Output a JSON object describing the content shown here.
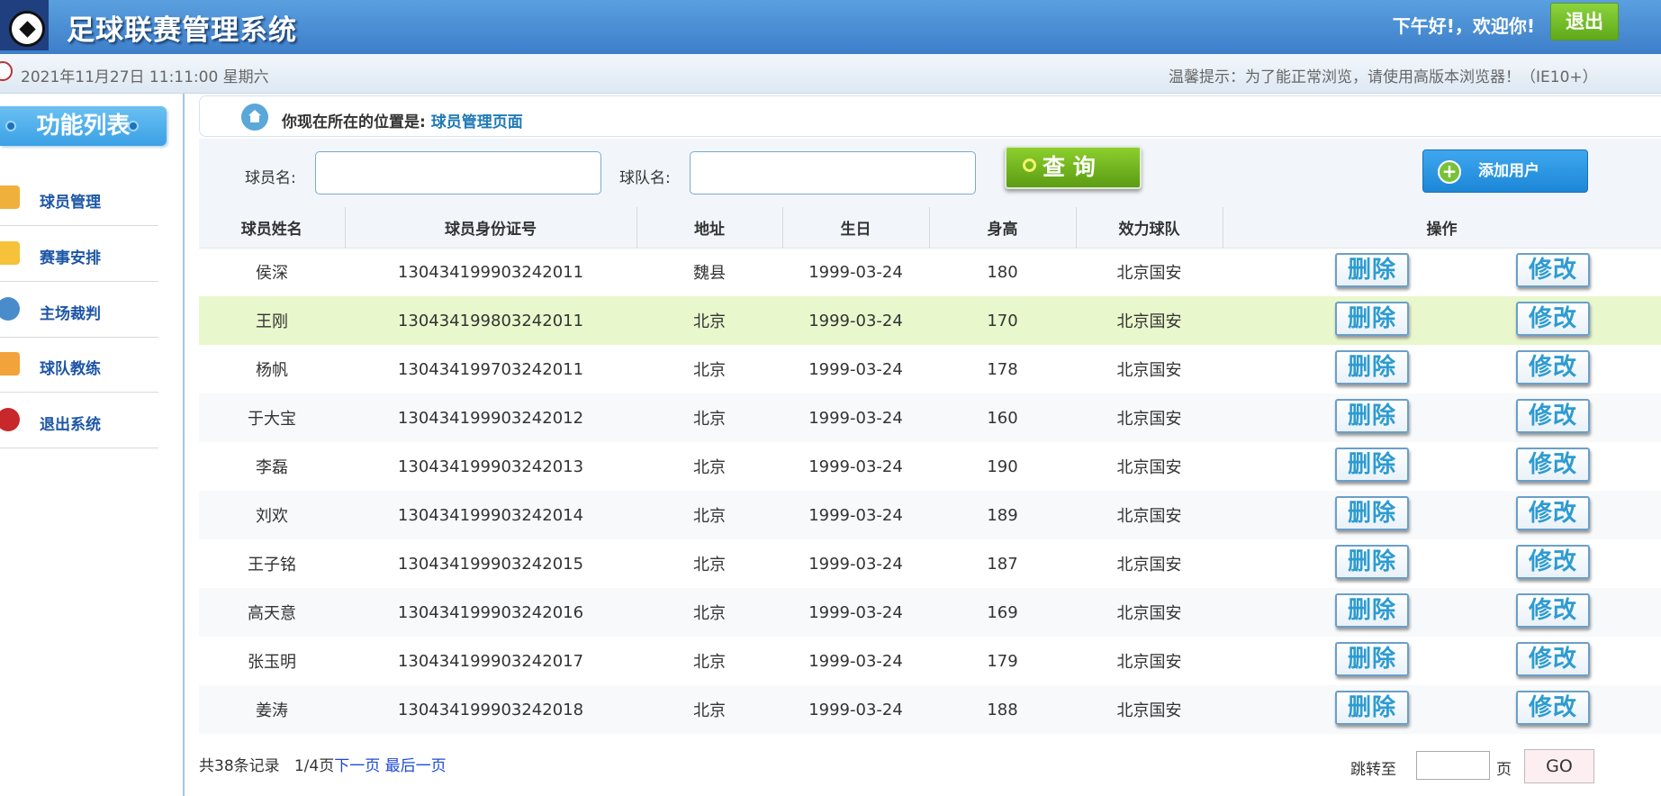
{
  "header": {
    "title": "足球联赛管理系统",
    "greeting": "下午好!，欢迎你!",
    "logout_label": "退出"
  },
  "subbar": {
    "datetime": "2021年11月27日 11:11:00 星期六",
    "tip": "温馨提示：为了能正常浏览，请使用高版本浏览器！（IE10+）"
  },
  "sidebar": {
    "title": "功能列表",
    "items": [
      {
        "label": "球员管理",
        "icon": "pencil-icon",
        "color": "#f0b13c"
      },
      {
        "label": "赛事安排",
        "icon": "schedule-icon",
        "color": "#f5c23a"
      },
      {
        "label": "主场裁判",
        "icon": "referee-icon",
        "color": "#4a8ccb"
      },
      {
        "label": "球队教练",
        "icon": "coach-icon",
        "color": "#f2a33a"
      },
      {
        "label": "退出系统",
        "icon": "exit-icon",
        "color": "#c8282a"
      }
    ]
  },
  "location": {
    "prefix": "你现在所在的位置是:",
    "page": "球员管理页面"
  },
  "search": {
    "player_label": "球员名:",
    "team_label": "球队名:",
    "query_label": "查 询",
    "add_label": "添加用户"
  },
  "table": {
    "columns": [
      "球员姓名",
      "球员身份证号",
      "地址",
      "生日",
      "身高",
      "效力球队",
      "操作"
    ],
    "delete_label": "删除",
    "edit_label": "修改",
    "rows": [
      {
        "name": "侯深",
        "id": "130434199903242011",
        "address": "魏县",
        "birthday": "1999-03-24",
        "height": "180",
        "team": "北京国安"
      },
      {
        "name": "王刚",
        "id": "130434199803242011",
        "address": "北京",
        "birthday": "1999-03-24",
        "height": "170",
        "team": "北京国安"
      },
      {
        "name": "杨帆",
        "id": "130434199703242011",
        "address": "北京",
        "birthday": "1999-03-24",
        "height": "178",
        "team": "北京国安"
      },
      {
        "name": "于大宝",
        "id": "130434199903242012",
        "address": "北京",
        "birthday": "1999-03-24",
        "height": "160",
        "team": "北京国安"
      },
      {
        "name": "李磊",
        "id": "130434199903242013",
        "address": "北京",
        "birthday": "1999-03-24",
        "height": "190",
        "team": "北京国安"
      },
      {
        "name": "刘欢",
        "id": "130434199903242014",
        "address": "北京",
        "birthday": "1999-03-24",
        "height": "189",
        "team": "北京国安"
      },
      {
        "name": "王子铭",
        "id": "130434199903242015",
        "address": "北京",
        "birthday": "1999-03-24",
        "height": "187",
        "team": "北京国安"
      },
      {
        "name": "高天意",
        "id": "130434199903242016",
        "address": "北京",
        "birthday": "1999-03-24",
        "height": "169",
        "team": "北京国安"
      },
      {
        "name": "张玉明",
        "id": "130434199903242017",
        "address": "北京",
        "birthday": "1999-03-24",
        "height": "179",
        "team": "北京国安"
      },
      {
        "name": "姜涛",
        "id": "130434199903242018",
        "address": "北京",
        "birthday": "1999-03-24",
        "height": "188",
        "team": "北京国安"
      }
    ]
  },
  "pager": {
    "total": "共38条记录",
    "page_info": "1/4页",
    "next": "下一页",
    "last": "最后一页",
    "jump_label": "跳转至",
    "page_unit": "页",
    "go_label": "GO"
  },
  "colors": {
    "header": "#4a8ed6",
    "accent_green": "#7ac13a",
    "accent_blue": "#2a93e0",
    "highlight_row": "#e9f8cc"
  }
}
